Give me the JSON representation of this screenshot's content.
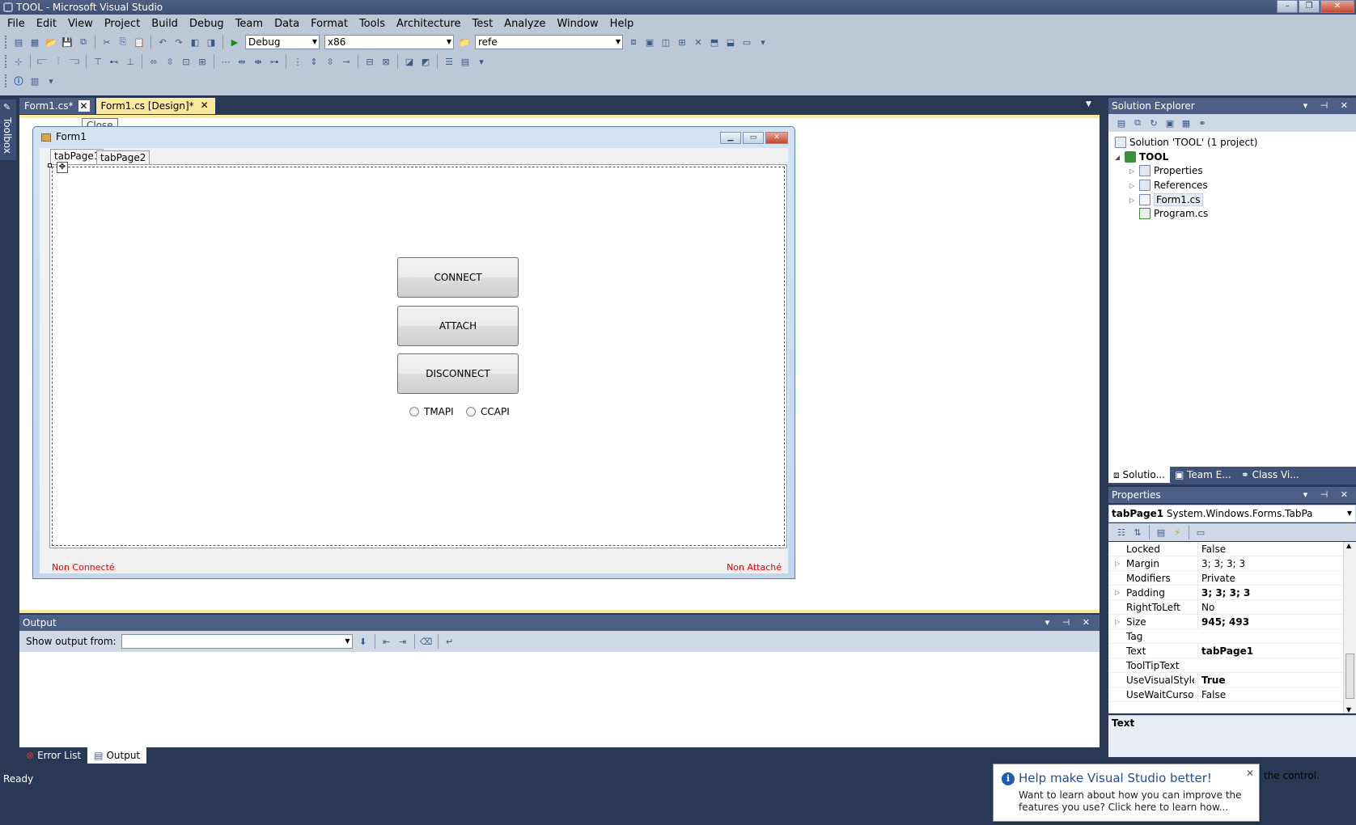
{
  "window": {
    "title": "TOOL - Microsoft Visual Studio"
  },
  "menu": [
    "File",
    "Edit",
    "View",
    "Project",
    "Build",
    "Debug",
    "Team",
    "Data",
    "Format",
    "Tools",
    "Architecture",
    "Test",
    "Analyze",
    "Window",
    "Help"
  ],
  "toolbar": {
    "config": "Debug",
    "platform": "x86",
    "search": "refe"
  },
  "toolbox": {
    "label": "Toolbox"
  },
  "doc_tabs": [
    {
      "label": "Form1.cs*"
    },
    {
      "label": "Form1.cs [Design]*"
    }
  ],
  "tooltip": "Close",
  "form": {
    "title": "Form1",
    "tabs": [
      "tabPage1",
      "tabPage2"
    ],
    "buttons": {
      "connect": "CONNECT",
      "attach": "ATTACH",
      "disconnect": "DISCONNECT"
    },
    "radios": {
      "tmapi": "TMAPI",
      "ccapi": "CCAPI"
    },
    "status_left": "Non Connecté",
    "status_right": "Non Attaché"
  },
  "solution_explorer": {
    "title": "Solution Explorer",
    "solution": "Solution 'TOOL' (1 project)",
    "project": "TOOL",
    "items": [
      "Properties",
      "References",
      "Form1.cs",
      "Program.cs"
    ],
    "tabs": [
      "Solutio...",
      "Team E...",
      "Class Vi..."
    ]
  },
  "properties": {
    "title": "Properties",
    "object_name": "tabPage1",
    "object_type": "System.Windows.Forms.TabPa",
    "rows": [
      {
        "name": "Locked",
        "value": "False",
        "bold": false,
        "expand": false
      },
      {
        "name": "Margin",
        "value": "3; 3; 3; 3",
        "bold": false,
        "expand": true
      },
      {
        "name": "Modifiers",
        "value": "Private",
        "bold": false,
        "expand": false
      },
      {
        "name": "Padding",
        "value": "3; 3; 3; 3",
        "bold": true,
        "expand": true
      },
      {
        "name": "RightToLeft",
        "value": "No",
        "bold": false,
        "expand": false
      },
      {
        "name": "Size",
        "value": "945; 493",
        "bold": true,
        "expand": true
      },
      {
        "name": "Tag",
        "value": "",
        "bold": false,
        "expand": false
      },
      {
        "name": "Text",
        "value": "tabPage1",
        "bold": true,
        "expand": false
      },
      {
        "name": "ToolTipText",
        "value": "",
        "bold": false,
        "expand": false
      },
      {
        "name": "UseVisualStyleBackColor",
        "value": "True",
        "bold": true,
        "expand": false
      },
      {
        "name": "UseWaitCursor",
        "value": "False",
        "bold": false,
        "expand": false
      }
    ],
    "desc_title": "Text",
    "desc_tail": "the control."
  },
  "output": {
    "title": "Output",
    "show_from_label": "Show output from:",
    "show_from_value": "",
    "tabs": [
      "Error List",
      "Output"
    ]
  },
  "status": {
    "text": "Ready"
  },
  "toast": {
    "title": "Help make Visual Studio better!",
    "body": "Want to learn about how you can improve the features you use? Click here to learn how..."
  },
  "colors": {
    "chrome": "#bcc7d8",
    "frame": "#293955",
    "active_tab": "#fce99b",
    "status_red": "#e00000",
    "toast_title": "#1f4f9a"
  }
}
